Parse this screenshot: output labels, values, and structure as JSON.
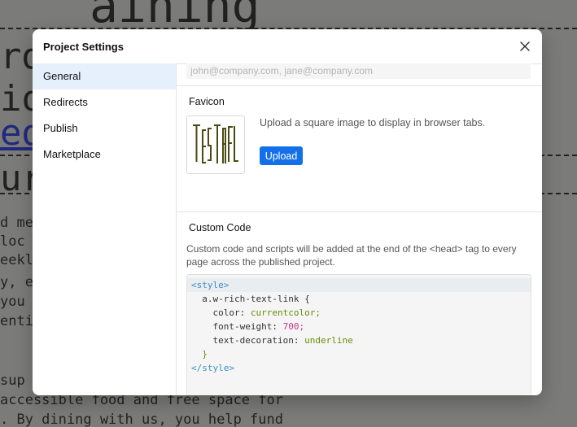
{
  "background": {
    "lines": [
      "aining",
      "rda",
      "io",
      "edi",
      "ur"
    ],
    "small_lines": [
      "d me",
      " loc",
      "eekl",
      "y, e",
      " you",
      "enti",
      " sup",
      " accessible food and free space for",
      ". By dining with us, you help fund"
    ]
  },
  "modal": {
    "title": "Project Settings",
    "close_icon": "close-icon"
  },
  "sidebar": {
    "items": [
      {
        "label": "General",
        "active": true
      },
      {
        "label": "Redirects",
        "active": false
      },
      {
        "label": "Publish",
        "active": false
      },
      {
        "label": "Marketplace",
        "active": false
      }
    ]
  },
  "content": {
    "email_placeholder": "john@company.com, jane@company.com",
    "favicon": {
      "title": "Favicon",
      "logo_text": "TestRatel",
      "description": "Upload a square image to display in browser tabs.",
      "upload_label": "Upload"
    },
    "custom_code": {
      "title": "Custom Code",
      "description": "Custom code and scripts will be added at the end of the <head> tag to every page across the published project.",
      "lines": {
        "l1_tag": "<style>",
        "l2_sel": "a.w-rich-text-link {",
        "l3_prop": "color",
        "l3_val": "currentcolor;",
        "l4_prop": "font-weight",
        "l4_val": "700;",
        "l5_prop": "text-decoration",
        "l5_val": "underline",
        "l6_close": "}",
        "l7_tag": "</style>"
      }
    }
  },
  "colors": {
    "accent": "#1470e8",
    "active_bg": "#e6f0fc"
  }
}
